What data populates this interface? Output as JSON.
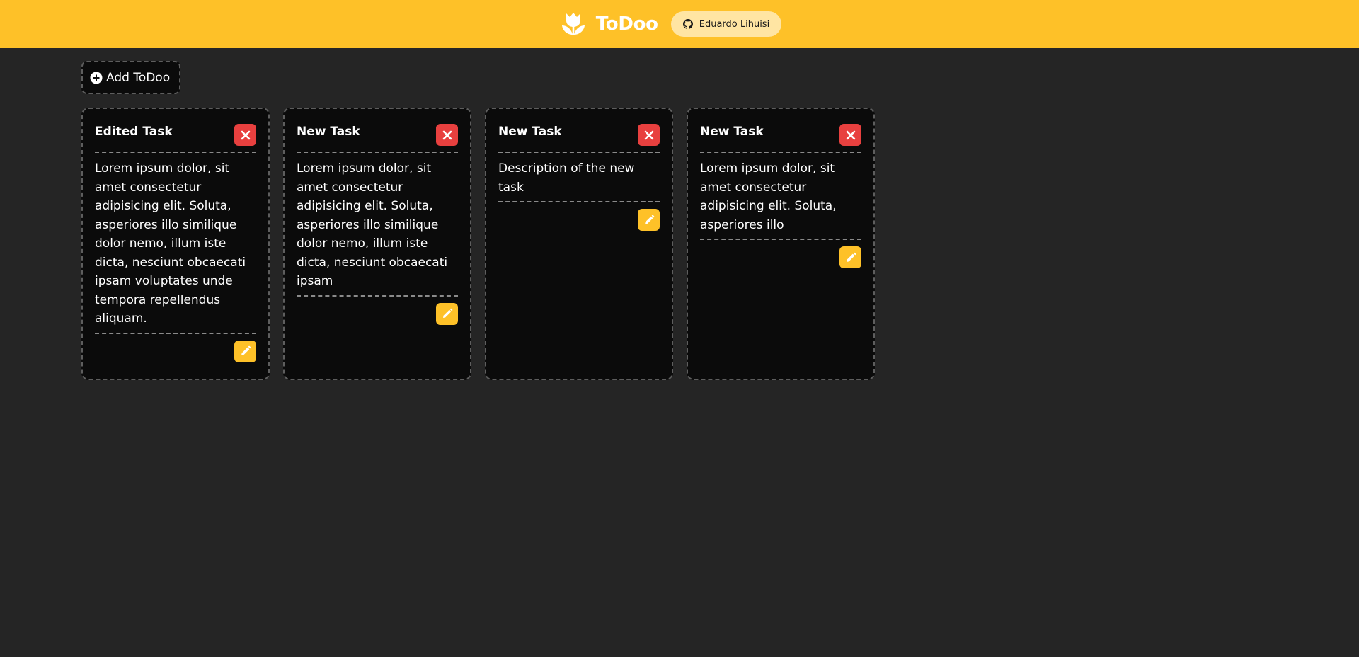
{
  "header": {
    "title": "ToDoo",
    "github_label": "Eduardo Lihuisi",
    "logo_icon": "tulip-icon",
    "brand_color": "#fec128"
  },
  "toolbar": {
    "add_label": "Add ToDoo"
  },
  "tasks": [
    {
      "title": "Edited Task",
      "description": "Lorem ipsum dolor, sit amet consectetur adipisicing elit. Soluta, asperiores illo similique dolor nemo, illum iste dicta, nesciunt obcaecati ipsam voluptates unde tempora repellendus aliquam."
    },
    {
      "title": "New Task",
      "description": "Lorem ipsum dolor, sit amet consectetur adipisicing elit. Soluta, asperiores illo similique dolor nemo, illum iste dicta, nesciunt obcaecati ipsam"
    },
    {
      "title": "New Task",
      "description": "Description of the new task"
    },
    {
      "title": "New Task",
      "description": "Lorem ipsum dolor, sit amet consectetur adipisicing elit. Soluta, asperiores illo"
    }
  ],
  "colors": {
    "delete": "#e8403f",
    "edit": "#fec128",
    "background": "#252525",
    "card": "#0b0b0b"
  }
}
